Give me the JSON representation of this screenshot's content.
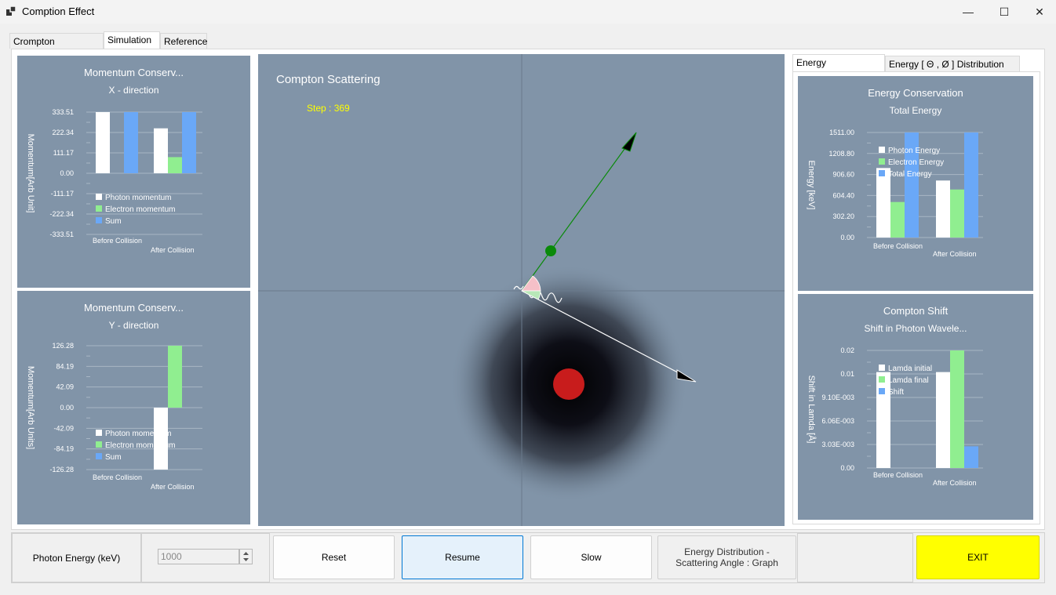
{
  "window": {
    "title": "Comption Effect",
    "minimize_glyph": "—",
    "maximize_glyph": "☐",
    "close_glyph": "✕"
  },
  "tabs": [
    {
      "label": "Crompton Scattering"
    },
    {
      "label": "Simulation"
    },
    {
      "label": "Reference"
    }
  ],
  "right_tabs": [
    {
      "label": "Energy Conservation"
    },
    {
      "label": "Energy [ Θ , Ø ] Distribution"
    }
  ],
  "simulation": {
    "title": "Compton Scattering",
    "step_text": "Step : 369",
    "step_color": "#ffff00"
  },
  "controls": {
    "photon_energy_label": "Photon Energy (keV)",
    "photon_energy_value": "1000",
    "reset_label": "Reset",
    "resume_label": "Resume",
    "slow_label": "Slow",
    "energy_dist_line1": "Energy Distribution -",
    "energy_dist_line2": "Scattering Angle : Graph",
    "exit_label": "EXIT"
  },
  "colors": {
    "panel_bg": "#8194a8",
    "photon": "#ffffff",
    "electron": "#90ee90",
    "sum": "#6aa8f7",
    "exit_bg": "#ffff00"
  },
  "chart_data": [
    {
      "id": "momentum-x",
      "type": "bar",
      "title": "Momentum  Conserv...",
      "subtitle": "X - direction",
      "ylabel": "Momentum[Arb Unit]",
      "categories": [
        "Before Collision",
        "After Collision"
      ],
      "ticks": [
        "333.51",
        "222.34",
        "111.17",
        "0.00",
        "-111.17",
        "-222.34",
        "-333.51"
      ],
      "ylim": [
        -333.51,
        333.51
      ],
      "legend": [
        "Photon momentum",
        "Electron momentum",
        "Sum"
      ],
      "series": [
        {
          "name": "Photon momentum",
          "values": [
            333.51,
            245
          ]
        },
        {
          "name": "Electron momentum",
          "values": [
            0,
            88
          ]
        },
        {
          "name": "Sum",
          "values": [
            333.51,
            333.51
          ]
        }
      ]
    },
    {
      "id": "momentum-y",
      "type": "bar",
      "title": "Momentum  Conserv...",
      "subtitle": "Y - direction",
      "ylabel": "Momentum[Arb Units]",
      "categories": [
        "Before Collision",
        "After Collision"
      ],
      "ticks": [
        "126.28",
        "84.19",
        "42.09",
        "0.00",
        "-42.09",
        "-84.19",
        "-126.28"
      ],
      "ylim": [
        -126.28,
        126.28
      ],
      "legend": [
        "Photon momentum",
        "Electron momentum",
        "Sum"
      ],
      "series": [
        {
          "name": "Photon momentum",
          "values": [
            0,
            -126.28
          ]
        },
        {
          "name": "Electron momentum",
          "values": [
            0,
            126.28
          ]
        },
        {
          "name": "Sum",
          "values": [
            0,
            0
          ]
        }
      ]
    },
    {
      "id": "energy-conservation",
      "type": "bar",
      "title": "Energy Conservation",
      "subtitle": "Total Energy",
      "ylabel": "Energy [keV]",
      "categories": [
        "Before Collision",
        "After Collision"
      ],
      "ticks": [
        "1511.00",
        "1208.80",
        "906.60",
        "604.40",
        "302.20",
        "0.00"
      ],
      "ylim": [
        0,
        1511
      ],
      "legend": [
        "Photon Energy",
        "Electron Energy",
        "Total Energy"
      ],
      "series": [
        {
          "name": "Photon Energy",
          "values": [
            1000,
            820
          ]
        },
        {
          "name": "Electron Energy",
          "values": [
            511,
            691
          ]
        },
        {
          "name": "Total Energy",
          "values": [
            1511,
            1511
          ]
        }
      ]
    },
    {
      "id": "compton-shift",
      "type": "bar",
      "title": "Compton Shift",
      "subtitle": "Shift in Photon Wavele...",
      "ylabel": "Shift in Lamda [Å]",
      "categories": [
        "Before Collision",
        "After Collision"
      ],
      "ticks": [
        "0.02",
        "0.01",
        "9.10E-003",
        "6.06E-003",
        "3.03E-003",
        "0.00"
      ],
      "ylim": [
        0,
        0.0152
      ],
      "legend": [
        "Lamda initial",
        "Lamda final",
        "Shift"
      ],
      "series": [
        {
          "name": "Lamda initial",
          "values": [
            0.0124,
            0.0124
          ]
        },
        {
          "name": "Lamda final",
          "values": [
            0,
            0.0152
          ]
        },
        {
          "name": "Shift",
          "values": [
            0,
            0.0028
          ]
        }
      ]
    }
  ]
}
